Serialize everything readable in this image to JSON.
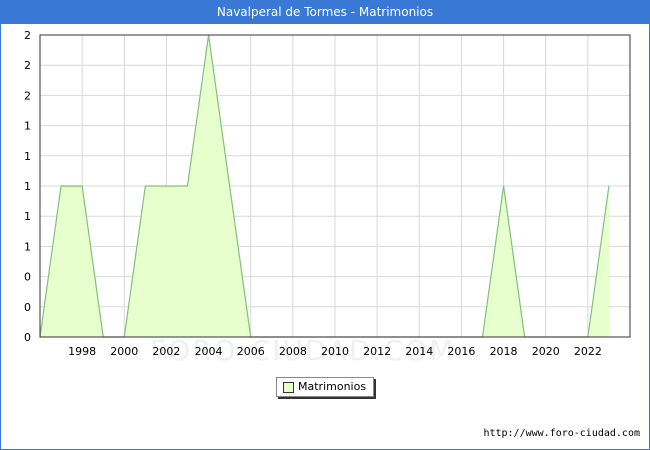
{
  "title": "Navalperal de Tormes - Matrimonios",
  "source_url": "http://www.foro-ciudad.com",
  "watermark": "FORO-CIUDAD.COM",
  "colors": {
    "header": "#3a78d6",
    "fill": "#e6ffcc",
    "line": "#80c080",
    "grid": "#d8d8d8"
  },
  "chart_data": {
    "type": "area",
    "title": "Navalperal de Tormes - Matrimonios",
    "xlabel": "",
    "ylabel": "",
    "x": [
      1996,
      1997,
      1998,
      1999,
      2000,
      2001,
      2002,
      2003,
      2004,
      2005,
      2006,
      2007,
      2008,
      2009,
      2010,
      2011,
      2012,
      2013,
      2014,
      2015,
      2016,
      2017,
      2018,
      2019,
      2020,
      2021,
      2022,
      2023
    ],
    "series": [
      {
        "name": "Matrimonios",
        "values": [
          0,
          1,
          1,
          0,
          0,
          1,
          1,
          1,
          2,
          1,
          0,
          0,
          0,
          0,
          0,
          0,
          0,
          0,
          0,
          0,
          0,
          0,
          1,
          0,
          0,
          0,
          0,
          1
        ]
      }
    ],
    "xlim": [
      1996,
      2024
    ],
    "ylim": [
      0,
      2
    ],
    "x_ticks": [
      1998,
      2000,
      2002,
      2004,
      2006,
      2008,
      2010,
      2012,
      2014,
      2016,
      2018,
      2020,
      2022
    ],
    "y_tick_values": [
      0,
      0.2,
      0.4,
      0.6,
      0.8,
      1,
      1.2,
      1.4,
      1.6,
      1.8,
      2
    ],
    "y_tick_labels": [
      "0",
      "0",
      "0",
      "1",
      "1",
      "1",
      "1",
      "1",
      "2",
      "2",
      "2"
    ],
    "grid": true,
    "legend": "bottom-center"
  }
}
